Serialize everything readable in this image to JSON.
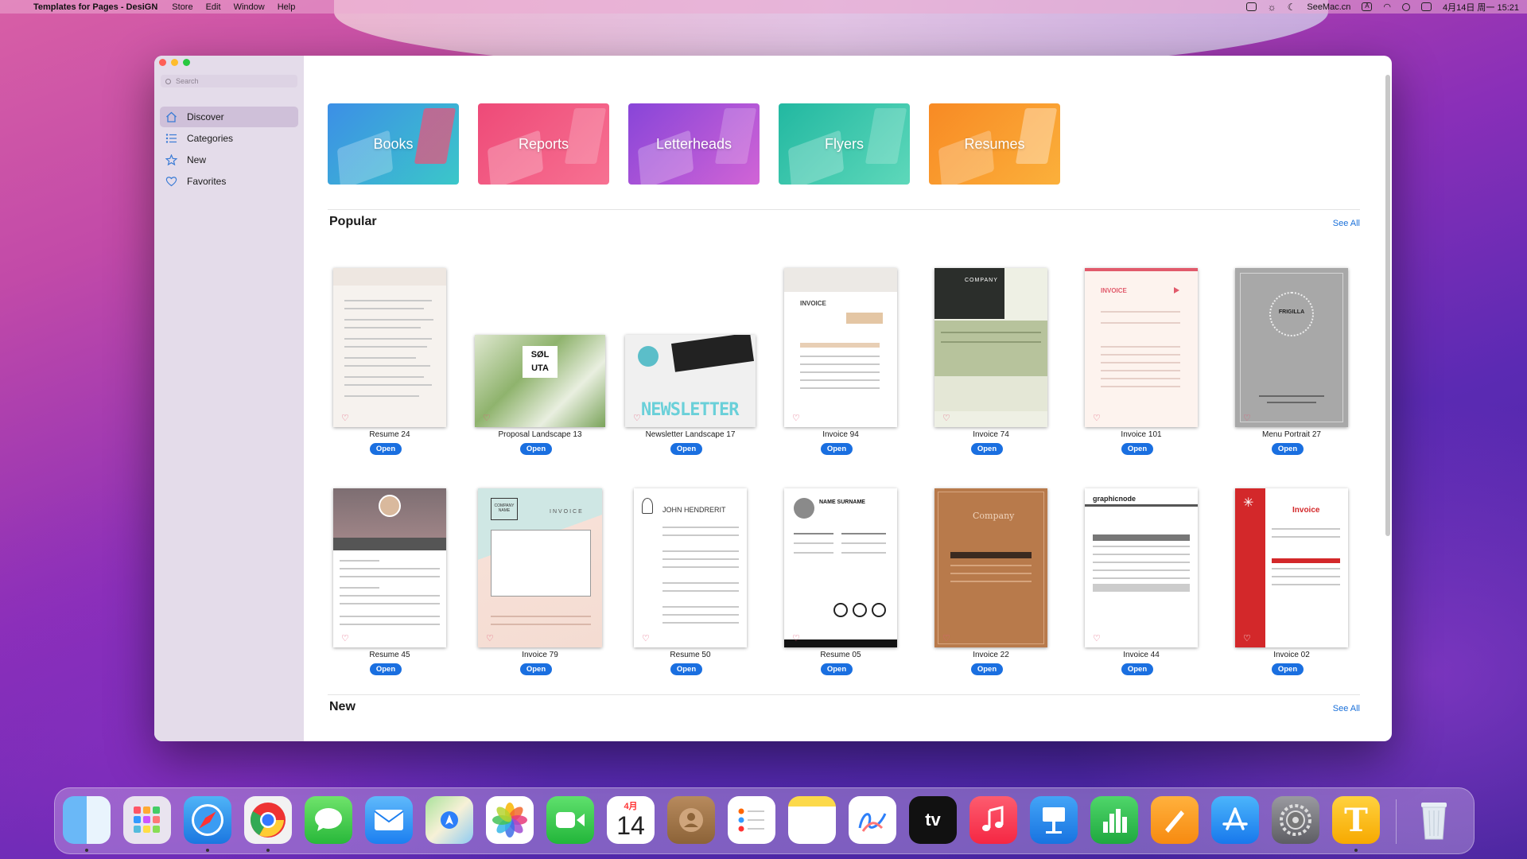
{
  "menubar": {
    "app_name": "Templates for Pages - DesiGN",
    "menus": [
      "Store",
      "Edit",
      "Window",
      "Help"
    ],
    "right_text": "SeeMac.cn",
    "date_time": "4月14日 周一 15:21"
  },
  "sidebar": {
    "search_placeholder": "Search",
    "items": [
      {
        "label": "Discover",
        "icon": "house-icon",
        "active": true
      },
      {
        "label": "Categories",
        "icon": "list-icon",
        "active": false
      },
      {
        "label": "New",
        "icon": "star-icon",
        "active": false
      },
      {
        "label": "Favorites",
        "icon": "heart-icon",
        "active": false
      }
    ]
  },
  "categories": [
    "Books",
    "Reports",
    "Letterheads",
    "Flyers",
    "Resumes"
  ],
  "popular": {
    "title": "Popular",
    "see_all": "See All",
    "row1": [
      "Resume 24",
      "Proposal Landscape 13",
      "Newsletter Landscape 17",
      "Invoice 94",
      "Invoice 74",
      "Invoice 101",
      "Menu Portrait 27"
    ],
    "row2": [
      "Resume 45",
      "Invoice 79",
      "Resume 50",
      "Resume 05",
      "Invoice 22",
      "Invoice 44",
      "Invoice 02"
    ],
    "open_label": "Open"
  },
  "thumb_text": {
    "proposal_word": "SØL UTA",
    "newsletter_word": "NEWSLETTER",
    "invoice": "INVOICE",
    "company": "COMPANY",
    "frigilla": "FRIGILLA",
    "company_name": "COMPANY NAME",
    "john": "JOHN HENDRERIT",
    "name_surname": "NAME SURNAME",
    "company_script": "Company",
    "graphicnode": "graphicnode",
    "invoice_title": "Invoice"
  },
  "new_section": {
    "title": "New",
    "see_all": "See All"
  },
  "dock": {
    "calendar_month": "4月",
    "calendar_day": "14",
    "tv_label": "tv",
    "text_app_letter": "T"
  }
}
